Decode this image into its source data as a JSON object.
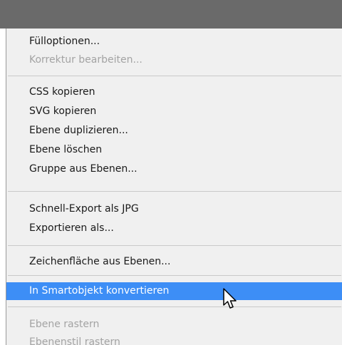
{
  "menu": {
    "items": [
      {
        "label": "Fülloptionen...",
        "enabled": true
      },
      {
        "label": "Korrektur bearbeiten...",
        "enabled": false
      },
      {
        "label": "CSS kopieren",
        "enabled": true
      },
      {
        "label": "SVG kopieren",
        "enabled": true
      },
      {
        "label": "Ebene duplizieren...",
        "enabled": true
      },
      {
        "label": "Ebene löschen",
        "enabled": true
      },
      {
        "label": "Gruppe aus Ebenen...",
        "enabled": true
      },
      {
        "label": "Schnell-Export als JPG",
        "enabled": true
      },
      {
        "label": "Exportieren als...",
        "enabled": true
      },
      {
        "label": "Zeichenfläche aus Ebenen...",
        "enabled": true
      },
      {
        "label": "In Smartobjekt konvertieren",
        "enabled": true,
        "highlighted": true
      },
      {
        "label": "Ebene rastern",
        "enabled": false
      },
      {
        "label": "Ebenenstil rastern",
        "enabled": false
      }
    ]
  },
  "colors": {
    "highlight": "#3d8ef6",
    "menu_background": "#f0f0f0",
    "disabled_text": "#a3a3a3",
    "top_bar": "#6a6a6a"
  },
  "cursor": {
    "icon": "arrow-pointer-icon"
  }
}
